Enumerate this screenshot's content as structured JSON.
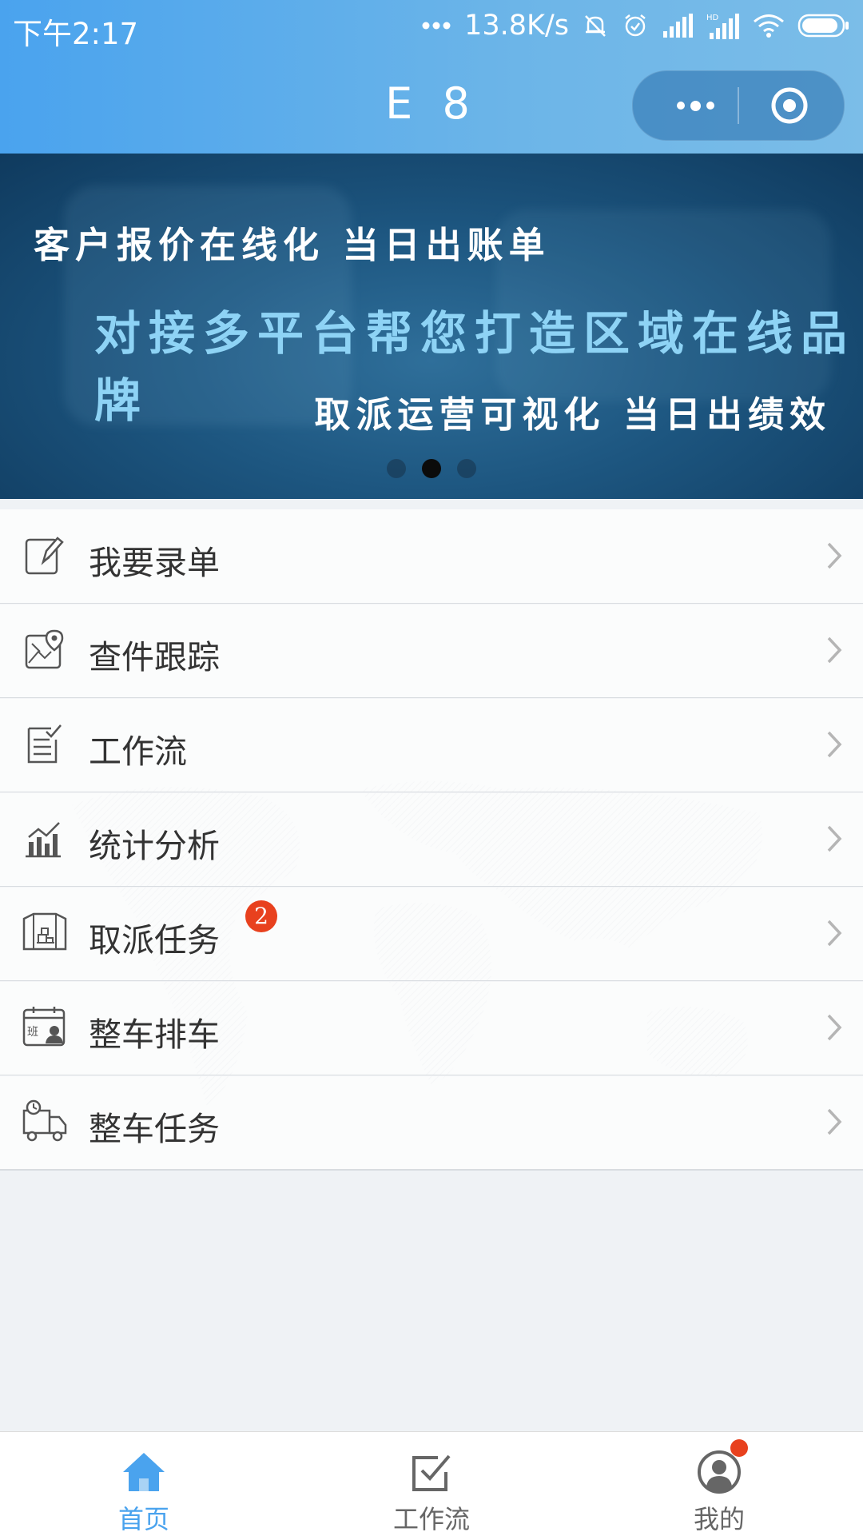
{
  "status_bar": {
    "time": "下午2:17",
    "net_speed": "13.8K/s",
    "icons": [
      "more-dots-icon",
      "mute-bell-icon",
      "alarm-icon",
      "signal-icon",
      "hd-signal-icon",
      "wifi-icon",
      "battery-icon"
    ]
  },
  "header": {
    "title": "E 8",
    "capsule": {
      "more_icon": "more-dots-icon",
      "close_icon": "target-icon"
    }
  },
  "banner": {
    "line1": "客户报价在线化 当日出账单",
    "line2": "对接多平台帮您打造区域在线品牌",
    "line3": "取派运营可视化 当日出绩效",
    "dots": 3,
    "active_index": 1
  },
  "menu": {
    "items": [
      {
        "label": "我要录单",
        "icon": "edit-document-icon"
      },
      {
        "label": "查件跟踪",
        "icon": "map-pin-icon"
      },
      {
        "label": "工作流",
        "icon": "checklist-icon"
      },
      {
        "label": "统计分析",
        "icon": "bar-chart-icon"
      },
      {
        "label": "取派任务",
        "icon": "warehouse-icon",
        "badge": "2"
      },
      {
        "label": "整车排车",
        "icon": "schedule-person-icon"
      },
      {
        "label": "整车任务",
        "icon": "truck-clock-icon"
      }
    ]
  },
  "tabbar": {
    "tabs": [
      {
        "label": "首页",
        "icon": "home-icon",
        "active": true
      },
      {
        "label": "工作流",
        "icon": "checkbox-icon",
        "active": false
      },
      {
        "label": "我的",
        "icon": "user-icon",
        "active": false,
        "has_dot": true
      }
    ],
    "active_color": "#4aa3ee",
    "inactive_color": "#666666"
  },
  "colors": {
    "header_gradient_start": "#4aa3ee",
    "badge": "#e8411e",
    "banner_highlight_text": "#8ed3f5"
  }
}
